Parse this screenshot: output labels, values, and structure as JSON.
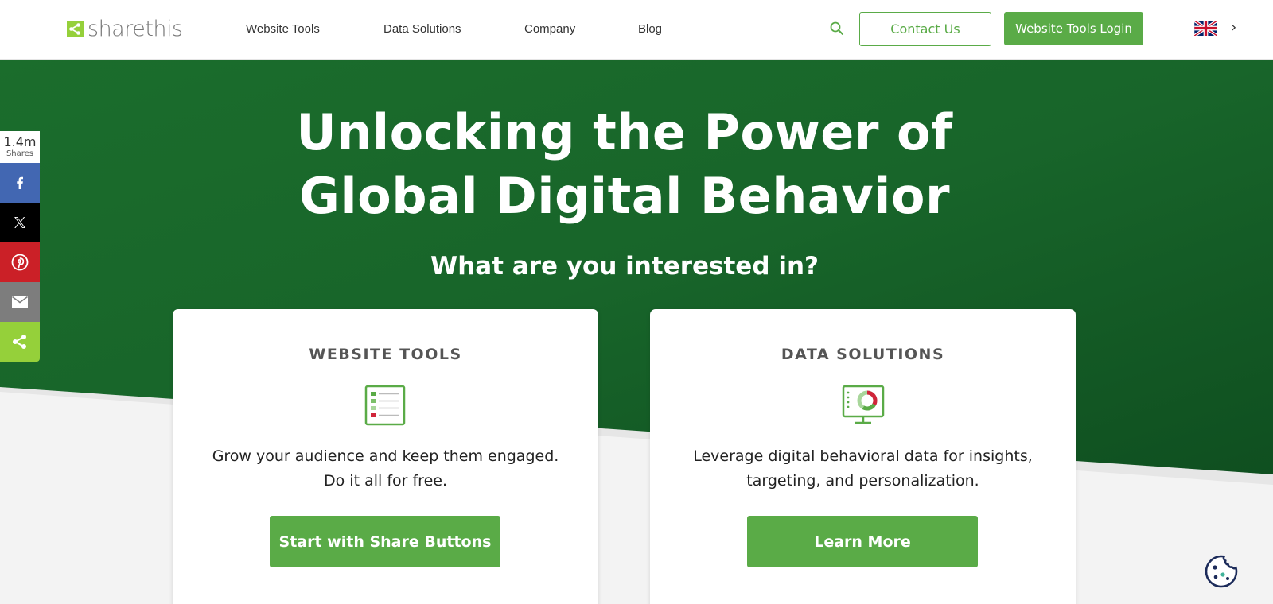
{
  "header": {
    "logo_text": "sharethis",
    "nav": [
      {
        "label": "Website Tools"
      },
      {
        "label": "Data Solutions"
      },
      {
        "label": "Company"
      },
      {
        "label": "Blog"
      }
    ],
    "contact_label": "Contact Us",
    "login_label": "Website Tools Login",
    "language_icon": "uk-flag-icon",
    "search_icon": "search-icon"
  },
  "hero": {
    "title_line1": "Unlocking the Power of",
    "title_line2": "Global Digital Behavior",
    "subtitle": "What are you interested in?"
  },
  "cards": [
    {
      "heading": "WEBSITE TOOLS",
      "icon": "checklist-icon",
      "desc_line1": "Grow your audience and keep them engaged.",
      "desc_line2": "Do it all for free.",
      "button": "Start with Share Buttons"
    },
    {
      "heading": "DATA SOLUTIONS",
      "icon": "analytics-monitor-icon",
      "desc_line1": "Leverage digital behavioral data for insights,",
      "desc_line2": "targeting, and personalization.",
      "button": "Learn More"
    }
  ],
  "share_bar": {
    "count": "1.4m",
    "count_label": "Shares",
    "buttons": [
      {
        "icon": "facebook-icon",
        "color": "#4267b2"
      },
      {
        "icon": "x-icon",
        "color": "#000000"
      },
      {
        "icon": "pinterest-icon",
        "color": "#cb2027"
      },
      {
        "icon": "email-icon",
        "color": "#7d7d7d"
      },
      {
        "icon": "sharethis-icon",
        "color": "#95d03a"
      }
    ]
  },
  "colors": {
    "brand_green": "#5aab47",
    "hero_dark_green": "#155c27",
    "hero_green": "#1a6b2a",
    "cookie_navy": "#1c2b5a"
  }
}
